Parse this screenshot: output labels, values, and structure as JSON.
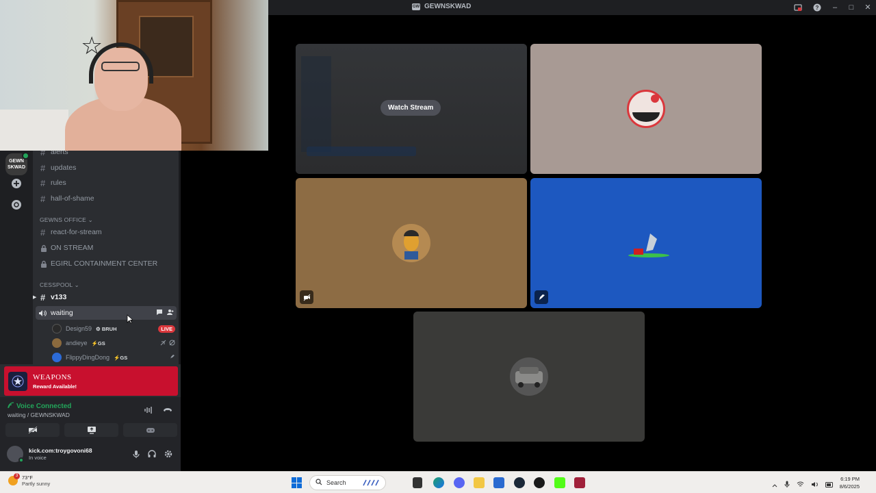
{
  "window": {
    "title": "GEWNSKWAD",
    "logo_text": "GW"
  },
  "server": {
    "abbr": "GEWN SKWAD"
  },
  "channels": [
    {
      "name": "alerts",
      "type": "text"
    },
    {
      "name": "updates",
      "type": "text"
    },
    {
      "name": "rules",
      "type": "text"
    },
    {
      "name": "hall-of-shame",
      "type": "text"
    }
  ],
  "categories": {
    "office": "GEWNS OFFICE",
    "cesspool": "CESSPOOL"
  },
  "office_channels": [
    {
      "name": "react-for-stream",
      "type": "text"
    },
    {
      "name": "ON STREAM",
      "type": "locked"
    },
    {
      "name": "EGIRL CONTAINMENT CENTER",
      "type": "locked"
    }
  ],
  "cesspool_channels": {
    "text": "v133",
    "voice": "waiting"
  },
  "members": [
    {
      "name": "Design59",
      "tag": "BRUH",
      "live": "LIVE"
    },
    {
      "name": "andieye",
      "tag": "GS"
    },
    {
      "name": "FlippyDingDong",
      "tag": "GS"
    }
  ],
  "reward": {
    "title": "WEAPONS",
    "subtitle": "Reward Available!"
  },
  "voice_panel": {
    "status": "Voice Connected",
    "location": "waiting / GEWNSKWAD"
  },
  "user": {
    "name": "kick.com:troygovoni68",
    "status": "In voice"
  },
  "stage": {
    "watch_label": "Watch Stream"
  },
  "taskbar": {
    "temp": "73°F",
    "weather": "Partly sunny",
    "search": "Search",
    "time": "6:19 PM",
    "date": "8/6/2025",
    "weather_badge": "3"
  },
  "colors": {
    "accent_green": "#23a55a",
    "live_red": "#da373c",
    "reward_red": "#c8102e",
    "tile_blue": "#1d58c0",
    "tile_tan": "#8d6c44"
  }
}
